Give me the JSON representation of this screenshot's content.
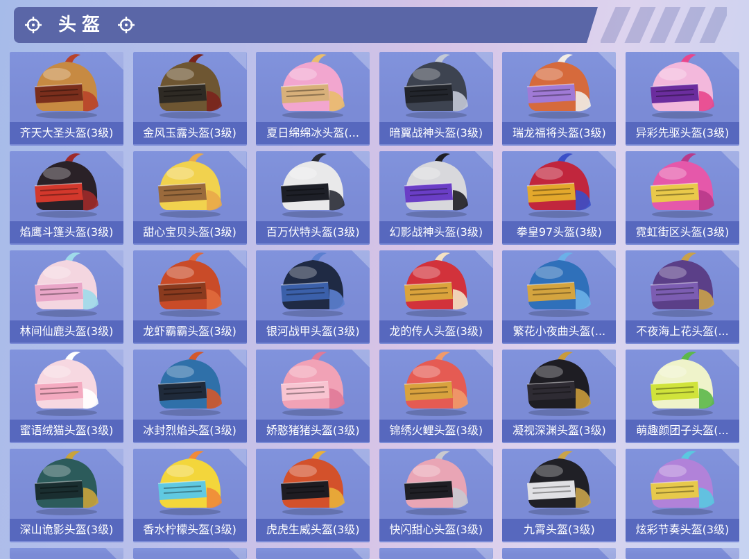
{
  "header": {
    "title": "头盔",
    "icon": "crosshair-icon"
  },
  "theme": {
    "header_bg": "#5a66a7",
    "card_bg": "#7b8bd6",
    "label_bg": "#5768be",
    "label_text": "#ffffff"
  },
  "items": [
    {
      "name": "齐天大圣头盔(3级)",
      "icon": "helmet-icon",
      "shell": "#c78a42",
      "visor": "#7a2e1c",
      "accent": "#b8432a"
    },
    {
      "name": "金风玉露头盔(3级)",
      "icon": "helmet-icon",
      "shell": "#6e5632",
      "visor": "#2e2a24",
      "accent": "#7a231c"
    },
    {
      "name": "夏日绵绵冰头盔(...",
      "icon": "helmet-icon",
      "shell": "#f2a6cf",
      "visor": "#d8b07a",
      "accent": "#e9bd6c"
    },
    {
      "name": "暗翼战神头盔(3级)",
      "icon": "helmet-icon",
      "shell": "#3d4350",
      "visor": "#22252c",
      "accent": "#c3c9d6"
    },
    {
      "name": "瑞龙福将头盔(3级)",
      "icon": "helmet-icon",
      "shell": "#d66a3c",
      "visor": "#a07ad6",
      "accent": "#f2ede6"
    },
    {
      "name": "异彩先驱头盔(3级)",
      "icon": "helmet-icon",
      "shell": "#f3b8dc",
      "visor": "#6b2d9e",
      "accent": "#e8468c"
    },
    {
      "name": "焰鹰斗篷头盔(3级)",
      "icon": "helmet-icon",
      "shell": "#2a2127",
      "visor": "#d3382c",
      "accent": "#9e2a2a"
    },
    {
      "name": "甜心宝贝头盔(3级)",
      "icon": "helmet-icon",
      "shell": "#f1d24e",
      "visor": "#9a6a3c",
      "accent": "#e9a94a"
    },
    {
      "name": "百万伏特头盔(3级)",
      "icon": "helmet-icon",
      "shell": "#e9e9ea",
      "visor": "#1d1f27",
      "accent": "#2a2c36"
    },
    {
      "name": "幻影战神头盔(3级)",
      "icon": "helmet-icon",
      "shell": "#d8d8dc",
      "visor": "#6a3ec6",
      "accent": "#1f1f25"
    },
    {
      "name": "拳皇97头盔(3级)",
      "icon": "helmet-icon",
      "shell": "#c1263d",
      "visor": "#e3a82c",
      "accent": "#3a4fc8"
    },
    {
      "name": "霓虹街区头盔(3级)",
      "icon": "helmet-icon",
      "shell": "#e558aa",
      "visor": "#e9c94a",
      "accent": "#b83a8a"
    },
    {
      "name": "林间仙鹿头盔(3级)",
      "icon": "helmet-icon",
      "shell": "#f4d6e0",
      "visor": "#e9a6c8",
      "accent": "#9fdaea"
    },
    {
      "name": "龙虾霸霸头盔(3级)",
      "icon": "helmet-icon",
      "shell": "#c94b28",
      "visor": "#8a3a1e",
      "accent": "#e06a3c"
    },
    {
      "name": "银河战甲头盔(3级)",
      "icon": "helmet-icon",
      "shell": "#1f2a44",
      "visor": "#3b60aa",
      "accent": "#5b7fd0"
    },
    {
      "name": "龙的传人头盔(3级)",
      "icon": "helmet-icon",
      "shell": "#d2323b",
      "visor": "#dba33c",
      "accent": "#f3e2c4"
    },
    {
      "name": "繁花小夜曲头盔(...",
      "icon": "helmet-icon",
      "shell": "#2f70ba",
      "visor": "#d4a43f",
      "accent": "#6bb0e8"
    },
    {
      "name": "不夜海上花头盔(...",
      "icon": "helmet-icon",
      "shell": "#5b3f88",
      "visor": "#7c5db2",
      "accent": "#c9a14a"
    },
    {
      "name": "蜜语绒猫头盔(3级)",
      "icon": "helmet-icon",
      "shell": "#f7d8e1",
      "visor": "#f4aac0",
      "accent": "#ffffff"
    },
    {
      "name": "冰封烈焰头盔(3级)",
      "icon": "helmet-icon",
      "shell": "#2f70a9",
      "visor": "#1f2a3a",
      "accent": "#d3582b"
    },
    {
      "name": "娇憨猪猪头盔(3级)",
      "icon": "helmet-icon",
      "shell": "#f1a2b6",
      "visor": "#f8c4d1",
      "accent": "#e07a98"
    },
    {
      "name": "锦绣火鲤头盔(3级)",
      "icon": "helmet-icon",
      "shell": "#e55b53",
      "visor": "#d9a23e",
      "accent": "#f09a6a"
    },
    {
      "name": "凝视深渊头盔(3级)",
      "icon": "helmet-icon",
      "shell": "#1e1d23",
      "visor": "#2e2b33",
      "accent": "#c99b3b"
    },
    {
      "name": "萌趣颜团子头盔(...",
      "icon": "helmet-icon",
      "shell": "#eff3ca",
      "visor": "#d0e33b",
      "accent": "#5cb84a"
    },
    {
      "name": "深山诡影头盔(3级)",
      "icon": "helmet-icon",
      "shell": "#2c5b5b",
      "visor": "#1a2e30",
      "accent": "#c9a33b"
    },
    {
      "name": "香水柠檬头盔(3级)",
      "icon": "helmet-icon",
      "shell": "#f3d63b",
      "visor": "#60c9e1",
      "accent": "#f08a3a"
    },
    {
      "name": "虎虎生威头盔(3级)",
      "icon": "helmet-icon",
      "shell": "#d3512b",
      "visor": "#1e1c22",
      "accent": "#e9b03a"
    },
    {
      "name": "快闪甜心头盔(3级)",
      "icon": "helmet-icon",
      "shell": "#e9a5b5",
      "visor": "#1f1f25",
      "accent": "#c9c9cf"
    },
    {
      "name": "九霄头盔(3级)",
      "icon": "helmet-icon",
      "shell": "#202026",
      "visor": "#e0e0e4",
      "accent": "#c9a34b"
    },
    {
      "name": "炫彩节奏头盔(3级)",
      "icon": "helmet-icon",
      "shell": "#b182d9",
      "visor": "#e7c94b",
      "accent": "#5ac8e0"
    }
  ]
}
